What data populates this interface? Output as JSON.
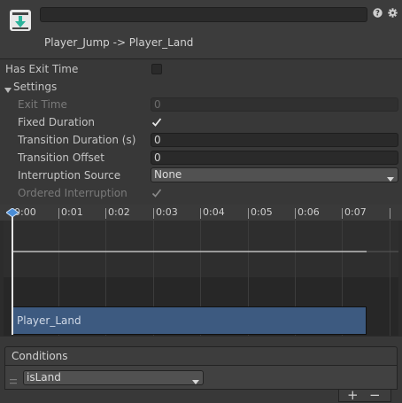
{
  "header": {
    "name_value": "",
    "transition_title": "Player_Jump -> Player_Land",
    "icons": [
      "transition-arrow-icon",
      "help-icon",
      "gear-icon"
    ]
  },
  "fields": {
    "has_exit_time": {
      "label": "Has Exit Time",
      "checked": false
    },
    "settings_label": "Settings",
    "exit_time": {
      "label": "Exit Time",
      "value": "0"
    },
    "fixed_duration": {
      "label": "Fixed Duration",
      "checked": true
    },
    "transition_duration": {
      "label": "Transition Duration (s)",
      "value": "0"
    },
    "transition_offset": {
      "label": "Transition Offset",
      "value": "0"
    },
    "interruption_source": {
      "label": "Interruption Source",
      "value": "None"
    },
    "ordered_interruption": {
      "label": "Ordered Interruption",
      "checked": true
    }
  },
  "timeline": {
    "ticks": [
      "0:00",
      "0:01",
      "0:02",
      "0:03",
      "0:04",
      "0:05",
      "0:06",
      "0:07"
    ],
    "clip_name": "Player_Land"
  },
  "conditions": {
    "title": "Conditions",
    "parameter": "isLand",
    "add_label": "+",
    "remove_label": "−"
  },
  "colors": {
    "accent_teal": "#4fd0b8",
    "clip_blue": "#3d5a80",
    "playhead_marker": "#4a8ed8"
  }
}
